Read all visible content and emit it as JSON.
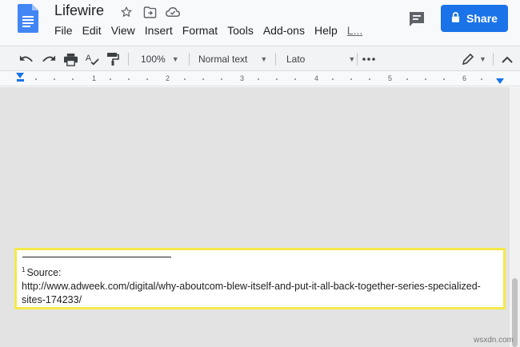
{
  "header": {
    "title": "Lifewire",
    "share_label": "Share"
  },
  "menu": [
    {
      "label": "File"
    },
    {
      "label": "Edit"
    },
    {
      "label": "View"
    },
    {
      "label": "Insert"
    },
    {
      "label": "Format"
    },
    {
      "label": "Tools"
    },
    {
      "label": "Add-ons"
    },
    {
      "label": "Help"
    },
    {
      "label": "L..."
    }
  ],
  "toolbar": {
    "zoom": "100%",
    "style": "Normal text",
    "font": "Lato"
  },
  "ruler": {
    "ticks": [
      "1",
      "2",
      "3",
      "4",
      "5",
      "6"
    ]
  },
  "footnote": {
    "number": "1",
    "label": "Source:",
    "url_line1": "http://www.adweek.com/digital/why-aboutcom-blew-itself-and-put-it-all-back-together-series-specialized-",
    "url_line2": "sites-174233/"
  },
  "watermark": "wsxdn.com",
  "colors": {
    "accent": "#1a73e8",
    "highlight": "#f5e94a"
  }
}
